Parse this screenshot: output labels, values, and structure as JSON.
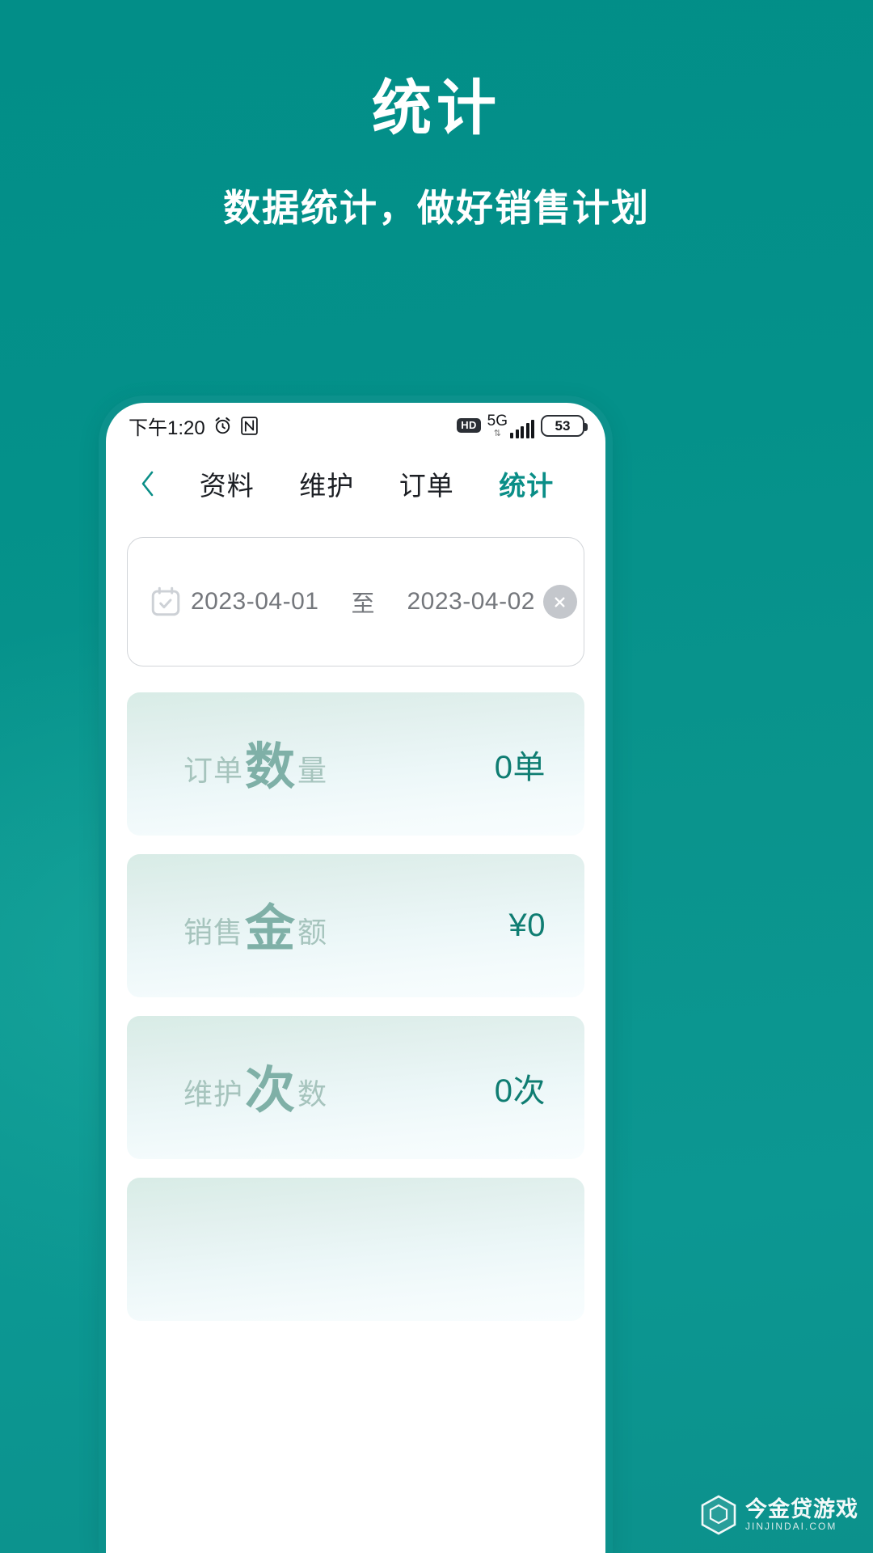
{
  "theme": {
    "brand_teal": "#0a8e87",
    "bg_teal": "#048b86",
    "value_teal": "#0f7d72",
    "label_green": "#7fb0a7"
  },
  "promo": {
    "title": "统计",
    "subtitle": "数据统计，做好销售计划"
  },
  "phone": {
    "statusbar": {
      "time": "下午1:20",
      "alarm_icon": "alarm-clock-icon",
      "nfc_icon": "nfc-icon",
      "hd_label": "HD",
      "network_label": "5G",
      "network_arrows": "⇅",
      "signal_bars": 5,
      "battery_level": "53"
    },
    "navbar": {
      "back_icon": "chevron-left-icon",
      "tabs": [
        {
          "label": "资料",
          "active": false
        },
        {
          "label": "维护",
          "active": false
        },
        {
          "label": "订单",
          "active": false
        },
        {
          "label": "统计",
          "active": true
        }
      ]
    },
    "date_range": {
      "calendar_icon": "calendar-check-icon",
      "start_date": "2023-04-01",
      "separator": "至",
      "end_date": "2023-04-02",
      "clear_icon": "close-circle-icon"
    },
    "stats": [
      {
        "label_prefix": "订单",
        "label_emphasis": "数",
        "label_suffix": "量",
        "value": "0单"
      },
      {
        "label_prefix": "销售",
        "label_emphasis": "金",
        "label_suffix": "额",
        "value": "¥0"
      },
      {
        "label_prefix": "维护",
        "label_emphasis": "次",
        "label_suffix": "数",
        "value": "0次"
      },
      {
        "label_prefix": "",
        "label_emphasis": "",
        "label_suffix": "",
        "value": ""
      }
    ]
  },
  "watermark": {
    "logo_icon": "hexagon-box-icon",
    "name": "今金贷游戏",
    "sub": "JINJINDAI.COM"
  }
}
